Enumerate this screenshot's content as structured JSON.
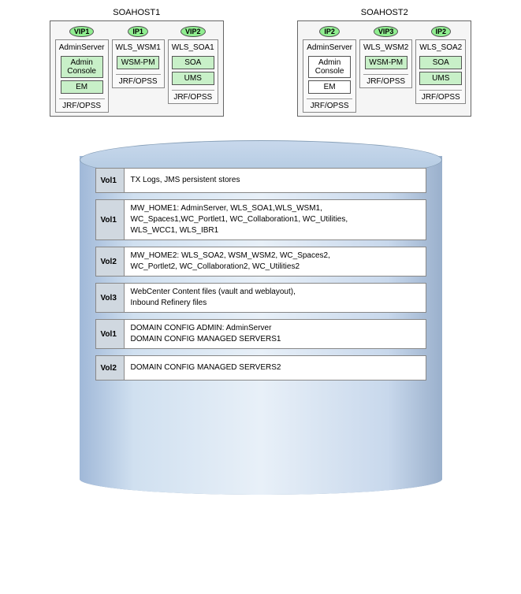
{
  "hosts": [
    {
      "label": "SOAHOST1",
      "servers": [
        {
          "badge": "VIP1",
          "name": "AdminServer",
          "boxes": [
            {
              "label": "Admin\nConsole",
              "type": "green"
            },
            {
              "label": "EM",
              "type": "green"
            }
          ],
          "jrf": "JRF/OPSS"
        },
        {
          "badge": "IP1",
          "name": "WLS_WSM1",
          "boxes": [
            {
              "label": "WSM-PM",
              "type": "green"
            }
          ],
          "jrf": "JRF/OPSS"
        },
        {
          "badge": "VIP2",
          "name": "WLS_SOA1",
          "boxes": [
            {
              "label": "SOA",
              "type": "green"
            },
            {
              "label": "UMS",
              "type": "green"
            }
          ],
          "jrf": "JRF/OPSS"
        }
      ]
    },
    {
      "label": "SOAHOST2",
      "servers": [
        {
          "badge": "IP2",
          "name": "AdminServer",
          "boxes": [
            {
              "label": "Admin\nConsole",
              "type": "white"
            },
            {
              "label": "EM",
              "type": "white"
            }
          ],
          "jrf": "JRF/OPSS"
        },
        {
          "badge": "VIP3",
          "name": "WLS_WSM2",
          "boxes": [
            {
              "label": "WSM-PM",
              "type": "green"
            }
          ],
          "jrf": "JRF/OPSS"
        },
        {
          "badge": "IP2",
          "name": "WLS_SOA2",
          "boxes": [
            {
              "label": "SOA",
              "type": "green"
            },
            {
              "label": "UMS",
              "type": "green"
            }
          ],
          "jrf": "JRF/OPSS"
        }
      ]
    }
  ],
  "storage_rows": [
    {
      "vol": "Vol1",
      "content": "TX Logs, JMS persistent stores"
    },
    {
      "vol": "Vol1",
      "content": "MW_HOME1: AdminServer, WLS_SOA1,WLS_WSM1,\nWC_Spaces1,WC_Portlet1, WC_Collaboration1, WC_Utilities,\nWLS_WCC1, WLS_IBR1"
    },
    {
      "vol": "Vol2",
      "content": "MW_HOME2: WLS_SOA2, WSM_WSM2, WC_Spaces2,\nWC_Portlet2, WC_Collaboration2, WC_Utilities2"
    },
    {
      "vol": "Vol3",
      "content": "WebCenter Content files (vault and weblayout),\nInbound Refinery files"
    },
    {
      "vol": "Vol1",
      "content": "DOMAIN CONFIG ADMIN: AdminServer\nDOMAIN CONFIG MANAGED SERVERS1"
    },
    {
      "vol": "Vol2",
      "content": "DOMAIN CONFIG MANAGED SERVERS2"
    }
  ]
}
